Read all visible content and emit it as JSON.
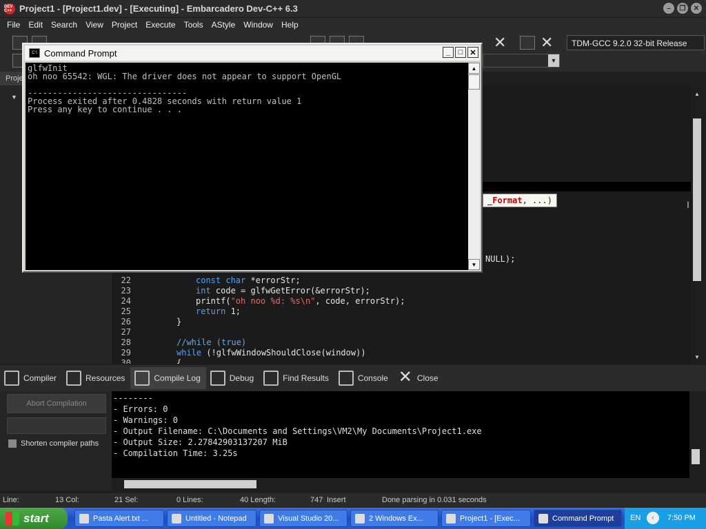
{
  "app": {
    "title": "Project1 - [Project1.dev] - [Executing] - Embarcadero Dev-C++ 6.3",
    "icon_text": "DEV C++"
  },
  "menu": [
    "File",
    "Edit",
    "Search",
    "View",
    "Project",
    "Execute",
    "Tools",
    "AStyle",
    "Window",
    "Help"
  ],
  "toolbar": {
    "compiler": "TDM-GCC 9.2.0 32-bit Release"
  },
  "left_panel": {
    "tab_label": "Proje"
  },
  "editor": {
    "tooltip_bold": "_Format",
    "tooltip_rest": ", ...)",
    "partial_line": "NULL);",
    "lines": [
      {
        "n": "22",
        "html": "<span class=\"kw\">const char</span> *errorStr;"
      },
      {
        "n": "23",
        "html": "<span class=\"kw\">int</span> code = glfwGetError(&amp;errorStr);"
      },
      {
        "n": "24",
        "html": "printf(<span class=\"str\">\"oh noo %d: %s\\n\"</span>, code, errorStr);"
      },
      {
        "n": "25",
        "html": "<span class=\"kw\">return</span> 1;"
      },
      {
        "n": "26",
        "html": "}"
      },
      {
        "n": "27",
        "html": ""
      },
      {
        "n": "28",
        "html": "<span class=\"cmt\">//while (true)</span>"
      },
      {
        "n": "29",
        "html": "<span class=\"kw\">while</span> (!glfwWindowShouldClose(window))"
      },
      {
        "n": "30",
        "html": "{"
      }
    ]
  },
  "bottom_tabs": [
    {
      "label": "Compiler",
      "name": "tab-compiler",
      "active": false
    },
    {
      "label": "Resources",
      "name": "tab-resources",
      "active": false
    },
    {
      "label": "Compile Log",
      "name": "tab-compile-log",
      "active": true
    },
    {
      "label": "Debug",
      "name": "tab-debug",
      "active": false
    },
    {
      "label": "Find Results",
      "name": "tab-find-results",
      "active": false
    },
    {
      "label": "Console",
      "name": "tab-console",
      "active": false
    },
    {
      "label": "Close",
      "name": "tab-close",
      "active": false
    }
  ],
  "compile_panel": {
    "abort_label": "Abort Compilation",
    "shorten_label": "Shorten compiler paths",
    "log": [
      "--------",
      "- Errors: 0",
      "- Warnings: 0",
      "- Output Filename: C:\\Documents and Settings\\VM2\\My Documents\\Project1.exe",
      "- Output Size: 2.27842903137207 MiB",
      "- Compilation Time: 3.25s"
    ]
  },
  "status": {
    "line_label": "Line:",
    "line_val": "13 Col:",
    "col_val": "21 Sel:",
    "sel_val": "0 Lines:",
    "lines_val": "40 Length:",
    "length_val": "747",
    "mode": "Insert",
    "message": "Done parsing in 0.031 seconds"
  },
  "cmd": {
    "title": "Command Prompt",
    "icon_text": "C:\\",
    "lines": [
      "glfwInit",
      "oh noo 65542: WGL: The driver does not appear to support OpenGL",
      "",
      "--------------------------------",
      "Process exited after 0.4828 seconds with return value 1",
      "Press any key to continue . . ."
    ]
  },
  "taskbar": {
    "start_label": "start",
    "tasks": [
      {
        "label": "Pasta Alert.txt ...",
        "active": false
      },
      {
        "label": "Untitled - Notepad",
        "active": false
      },
      {
        "label": "Visual Studio 20...",
        "active": false
      },
      {
        "label": "2 Windows Ex...",
        "active": false
      },
      {
        "label": "Project1 - [Exec...",
        "active": false
      },
      {
        "label": "Command Prompt",
        "active": true
      }
    ],
    "lang": "EN",
    "clock": "7:50 PM"
  }
}
